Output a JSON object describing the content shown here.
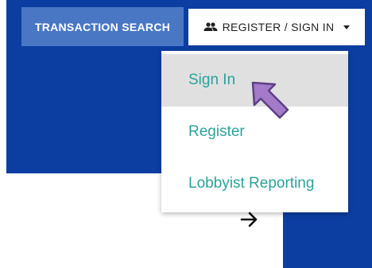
{
  "nav": {
    "transaction_search_label": "TRANSACTION SEARCH",
    "register_signin_label": "REGISTER / SIGN IN"
  },
  "dropdown": {
    "items": [
      {
        "label": "Sign In"
      },
      {
        "label": "Register"
      },
      {
        "label": "Lobbyist Reporting"
      }
    ]
  },
  "icons": {
    "register_icon": "people-icon",
    "dropdown_icon": "caret-down-icon",
    "pointer_icon": "pointer-arrow-icon",
    "next_icon": "arrow-right-icon"
  },
  "colors": {
    "header_blue": "#0c3ea2",
    "search_button": "#4a77c4",
    "menu_text": "#2aa39a",
    "menu_active_bg": "#e0e0e0",
    "pointer_fill": "#a47bc9"
  }
}
